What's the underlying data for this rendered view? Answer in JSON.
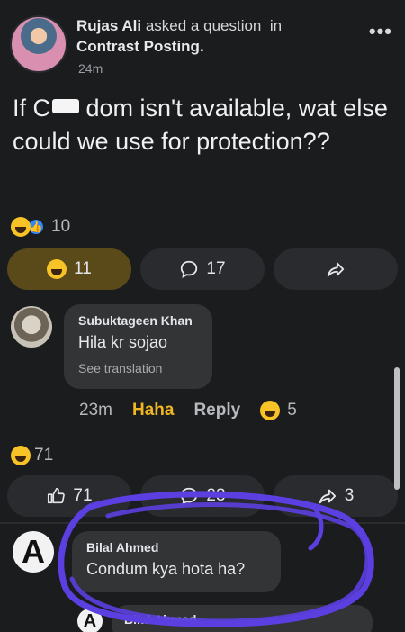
{
  "post": {
    "author": "Rujas Ali",
    "action": "asked a question",
    "in_word": "in",
    "group": "Contrast Posting.",
    "time": "24m",
    "more": "•••",
    "question_prefix": "If C",
    "question_rest": " dom isn't available, wat else could we use for protection??",
    "reaction_total": "10"
  },
  "actions": {
    "haha_count": "11",
    "comment_count": "17"
  },
  "comment1": {
    "name": "Subuktageen Khan",
    "text": "Hila kr sojao",
    "translation": "See translation",
    "time": "23m",
    "reaction_label": "Haha",
    "reply_label": "Reply",
    "reaction_count": "5"
  },
  "second_post": {
    "reaction_total": "71",
    "like_count": "71",
    "comment_count": "23",
    "share_count": "3"
  },
  "comment2": {
    "name": "Bilal Ahmed",
    "text": "Condum kya hota ha?",
    "partial_name": "Bilal Ahmed"
  },
  "colors": {
    "background": "#1b1c1e",
    "haha_accent": "#f0b523",
    "like_blue": "#2d88ff",
    "scribble": "#5b3fe0"
  }
}
